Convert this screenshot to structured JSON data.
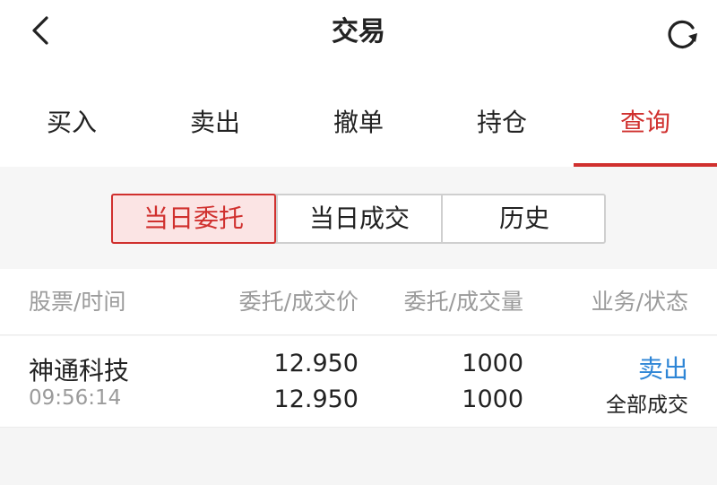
{
  "header": {
    "title": "交易",
    "back_icon": "chevron-left-icon",
    "refresh_icon": "refresh-icon"
  },
  "tabs": [
    {
      "label": "买入",
      "active": false
    },
    {
      "label": "卖出",
      "active": false
    },
    {
      "label": "撤单",
      "active": false
    },
    {
      "label": "持仓",
      "active": false
    },
    {
      "label": "查询",
      "active": true
    }
  ],
  "segments": [
    {
      "label": "当日委托",
      "active": true
    },
    {
      "label": "当日成交",
      "active": false
    },
    {
      "label": "历史",
      "active": false
    }
  ],
  "columns": [
    "股票/时间",
    "委托/成交价",
    "委托/成交量",
    "业务/状态"
  ],
  "orders": [
    {
      "name": "神通科技",
      "time": "09:56:14",
      "order_price": "12.950",
      "deal_price": "12.950",
      "order_qty": "1000",
      "deal_qty": "1000",
      "business": "卖出",
      "status": "全部成交"
    }
  ],
  "colors": {
    "accent_red": "#d0302e",
    "link_blue": "#2f86d6",
    "muted_gray": "#9b9b9b"
  }
}
